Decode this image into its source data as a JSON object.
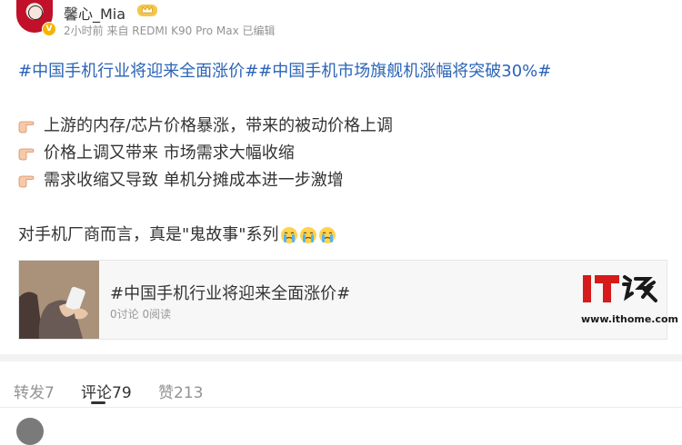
{
  "post": {
    "username": "馨心_Mia",
    "vip_icon": "crown-vip-icon",
    "meta": "2小时前 来自 REDMI K90 Pro Max 已编辑",
    "topics": "#中国手机行业将迎来全面涨价##中国手机市场旗舰机涨幅将突破30%#",
    "bullets": [
      "上游的内存/芯片价格暴涨，带来的被动价格上调",
      "价格上调又带来 市场需求大幅收缩",
      "需求收缩又导致 单机分摊成本进一步激增"
    ],
    "bullet_icon": "pointing-hand-icon",
    "closing": "对手机厂商而言，真是\"鬼故事\"系列",
    "closing_emoji": "crying-face-icon"
  },
  "card": {
    "title": "#中国手机行业将迎来全面涨价#",
    "stats": "0讨论 0阅读",
    "logo_text": "IT之家",
    "logo_url": "www.ithome.com"
  },
  "tabs": [
    {
      "label": "转发7"
    },
    {
      "label": "评论79"
    },
    {
      "label": "赞213"
    }
  ],
  "active_tab": "评论79",
  "colors": {
    "topic_link": "#2a64b8",
    "logo_red": "#d71a1a",
    "text_primary": "#333333",
    "text_secondary": "#939393"
  }
}
